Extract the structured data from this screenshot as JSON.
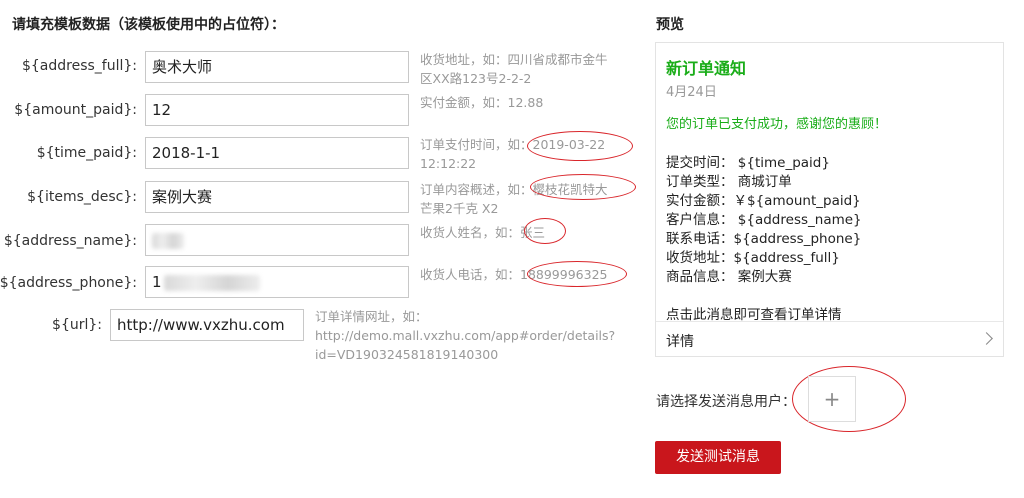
{
  "form": {
    "title": "请填充模板数据（该模板使用中的占位符）：",
    "fields": [
      {
        "label": "${address_full}:",
        "value": "奥术大师",
        "hint1": "收货地址，如：四川省成都市金牛",
        "hint2": "区XX路123号2-2-2"
      },
      {
        "label": "${amount_paid}:",
        "value": "12",
        "hint1": "实付金额，如：12.88"
      },
      {
        "label": "${time_paid}:",
        "value": "2018-1-1",
        "hint1": "订单支付时间，如：2019-03-22",
        "hint2": "12:12:22"
      },
      {
        "label": "${items_desc}:",
        "value": "案例大赛",
        "hint1": "订单内容概述，如：樱枝花凯特大",
        "hint2": "芒果2千克 X2"
      },
      {
        "label": "${address_name}:",
        "value": "",
        "hint1": "收货人姓名，如：张三"
      },
      {
        "label": "${address_phone}:",
        "value": "1",
        "hint1": "收货人电话，如：18899996325"
      },
      {
        "label": "${url}:",
        "value": "http://www.vxzhu.com",
        "hint1": "订单详情网址，如：",
        "hint2": "http://demo.mall.vxzhu.com/app#order/details?",
        "hint3": "id=VD190324581819140300"
      }
    ]
  },
  "preview": {
    "title": "预览",
    "card_title": "新订单通知",
    "date": "4月24日",
    "message": "您的订单已支付成功，感谢您的惠顾！",
    "lines": [
      "提交时间：  ${time_paid}",
      "订单类型：  商城订单",
      "实付金额：￥${amount_paid}",
      "客户信息：  ${address_name}",
      "联系电话：${address_phone}",
      "收货地址：${address_full}",
      "商品信息：  案例大赛"
    ],
    "footer_note": "点击此消息即可查看订单详情",
    "detail_label": "详情"
  },
  "select_user_label": "请选择发送消息用户：",
  "add_icon": "+",
  "send_button": "发送测试消息",
  "colors": {
    "accent_green": "#1aad19",
    "send_red": "#c9161c",
    "annotation_red": "#d9262b"
  }
}
